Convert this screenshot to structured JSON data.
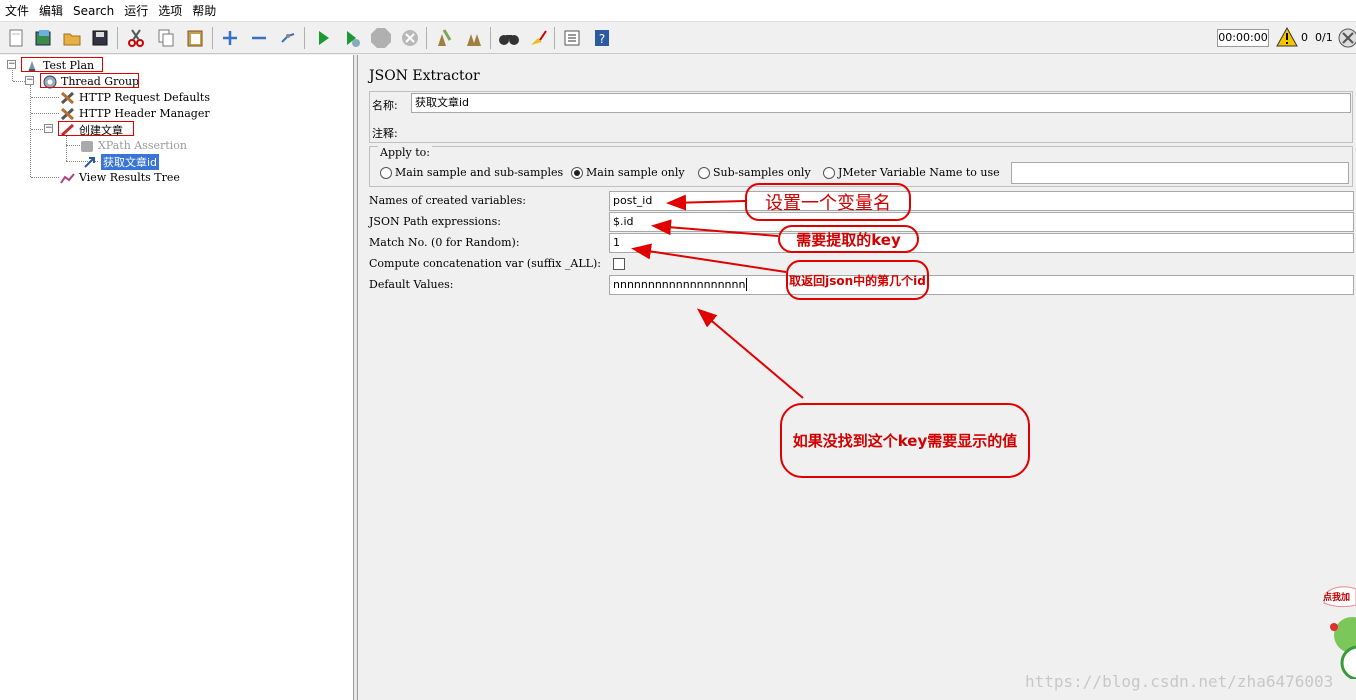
{
  "menu": [
    "文件",
    "编辑",
    "Search",
    "运行",
    "选项",
    "帮助"
  ],
  "status": {
    "timer": "00:00:00",
    "warnings": "0",
    "threads": "0/1"
  },
  "tree": {
    "test_plan": "Test Plan",
    "thread_group": "Thread Group",
    "http_defaults": "HTTP Request Defaults",
    "http_header": "HTTP Header Manager",
    "create_article": "创建文章",
    "xpath_assertion": "XPath Assertion",
    "get_article_id": "获取文章id",
    "view_results": "View Results Tree"
  },
  "panel": {
    "title": "JSON Extractor",
    "name_label": "名称:",
    "name_value": "获取文章id",
    "comment_label": "注释:",
    "comment_value": "",
    "apply_to_label": "Apply to:",
    "apply_options": [
      "Main sample and sub-samples",
      "Main sample only",
      "Sub-samples only",
      "JMeter Variable Name to use"
    ],
    "apply_selected": "Main sample only",
    "jmeter_var_value": "",
    "fields": {
      "variables_label": "Names of created variables:",
      "variables_value": "post_id",
      "json_path_label": "JSON Path expressions:",
      "json_path_value": "$.id",
      "match_no_label": "Match No. (0 for Random):",
      "match_no_value": "1",
      "concat_label": "Compute concatenation var (suffix _ALL):",
      "default_label": "Default Values:",
      "default_value": "nnnnnnnnnnnnnnnnnnn"
    }
  },
  "annotations": {
    "set_var_name": "设置一个变量名",
    "key_to_extract": "需要提取的key",
    "nth_id": "取返回json中的第几个id",
    "default_display": "如果没找到这个key需要显示的值"
  },
  "watermark": "https://blog.csdn.net/zha6476003",
  "floater_text": "点我加",
  "colors": {
    "annotation_red": "#e00000",
    "selection_blue": "#3875d7"
  }
}
